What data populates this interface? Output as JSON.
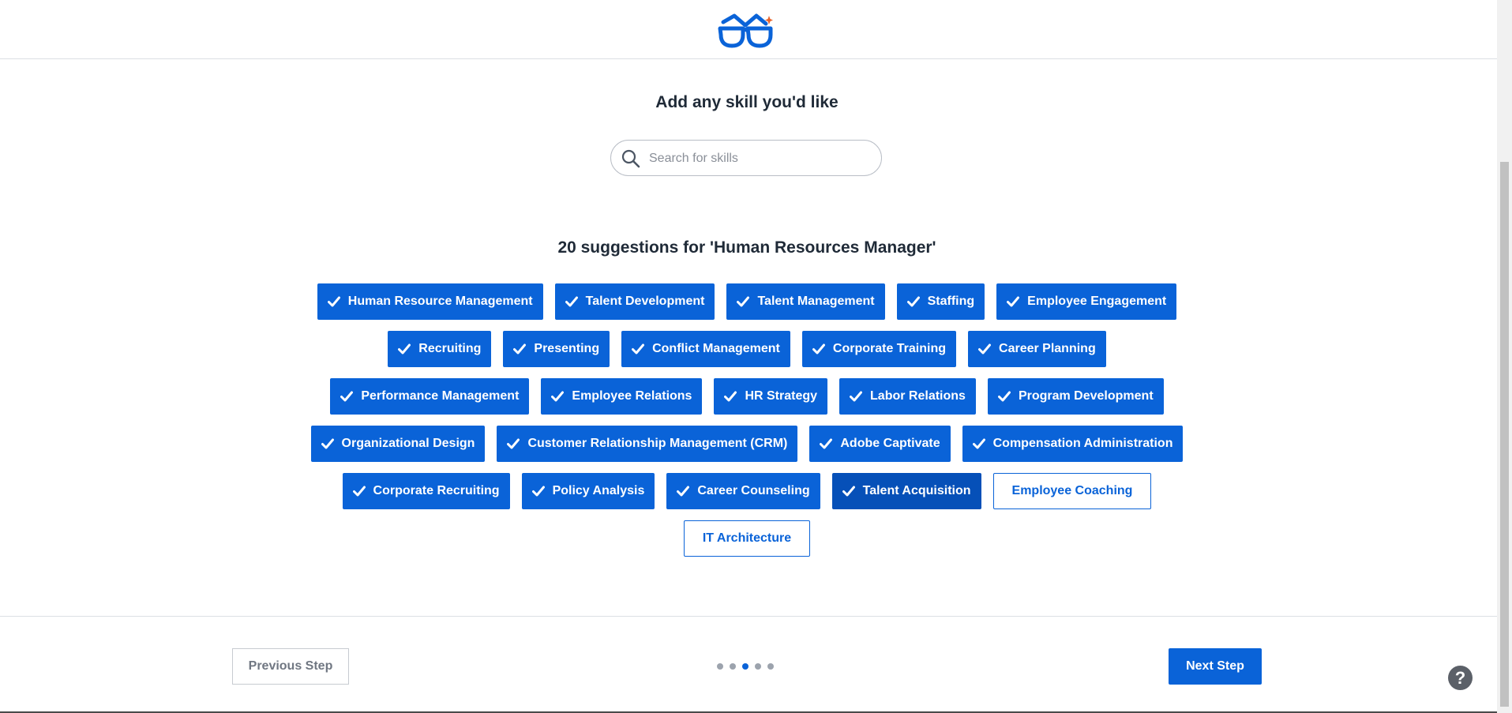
{
  "header": {
    "logo_icon": "glasses-logo-icon"
  },
  "main": {
    "title": "Add any skill you'd like",
    "search": {
      "placeholder": "Search for skills",
      "value": "",
      "icon": "search-icon"
    },
    "suggestions_title": "20 suggestions for 'Human Resources Manager'",
    "chip_rows": [
      [
        {
          "label": "Human Resource Management",
          "selected": true
        },
        {
          "label": "Talent Development",
          "selected": true
        },
        {
          "label": "Talent Management",
          "selected": true
        },
        {
          "label": "Staffing",
          "selected": true
        },
        {
          "label": "Employee Engagement",
          "selected": true
        }
      ],
      [
        {
          "label": "Recruiting",
          "selected": true
        },
        {
          "label": "Presenting",
          "selected": true
        },
        {
          "label": "Conflict Management",
          "selected": true
        },
        {
          "label": "Corporate Training",
          "selected": true
        },
        {
          "label": "Career Planning",
          "selected": true
        }
      ],
      [
        {
          "label": "Performance Management",
          "selected": true
        },
        {
          "label": "Employee Relations",
          "selected": true
        },
        {
          "label": "HR Strategy",
          "selected": true
        },
        {
          "label": "Labor Relations",
          "selected": true
        },
        {
          "label": "Program Development",
          "selected": true
        }
      ],
      [
        {
          "label": "Organizational Design",
          "selected": true
        },
        {
          "label": "Customer Relationship Management (CRM)",
          "selected": true
        },
        {
          "label": "Adobe Captivate",
          "selected": true
        },
        {
          "label": "Compensation Administration",
          "selected": true
        }
      ],
      [
        {
          "label": "Corporate Recruiting",
          "selected": true
        },
        {
          "label": "Policy Analysis",
          "selected": true
        },
        {
          "label": "Career Counseling",
          "selected": true
        },
        {
          "label": "Talent Acquisition",
          "selected": true,
          "hovered": true
        },
        {
          "label": "Employee Coaching",
          "selected": false
        }
      ],
      [
        {
          "label": "IT Architecture",
          "selected": false
        }
      ]
    ]
  },
  "footer": {
    "prev_label": "Previous Step",
    "next_label": "Next Step",
    "steps_total": 5,
    "steps_current": 3,
    "help_label": "?"
  },
  "colors": {
    "primary": "#0a63d8",
    "primary_hover": "#0650b8",
    "dot_inactive": "#9ca3ad",
    "help_bg": "#5b6068"
  }
}
